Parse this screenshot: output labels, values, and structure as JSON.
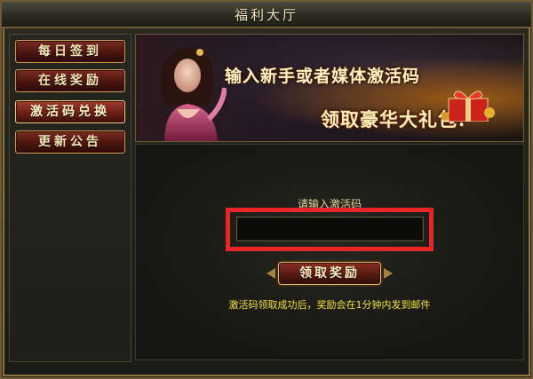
{
  "window": {
    "title": "福利大厅"
  },
  "sidebar": {
    "items": [
      {
        "label": "每日签到",
        "active": false
      },
      {
        "label": "在线奖励",
        "active": false
      },
      {
        "label": "激活码兑换",
        "active": true
      },
      {
        "label": "更新公告",
        "active": false
      }
    ]
  },
  "banner": {
    "line1": "输入新手或者媒体激活码",
    "line2": "领取豪华大礼包!"
  },
  "redeem": {
    "prompt": "请输入激活码",
    "input_value": "",
    "claim_label": "领取奖励",
    "notice": "激活码领取成功后，奖励会在1分钟内发到邮件"
  },
  "colors": {
    "accent_gold": "#c89a52",
    "button_red": "#7b2b22",
    "highlight_red": "#e8262a",
    "notice_yellow": "#f3e23a"
  }
}
